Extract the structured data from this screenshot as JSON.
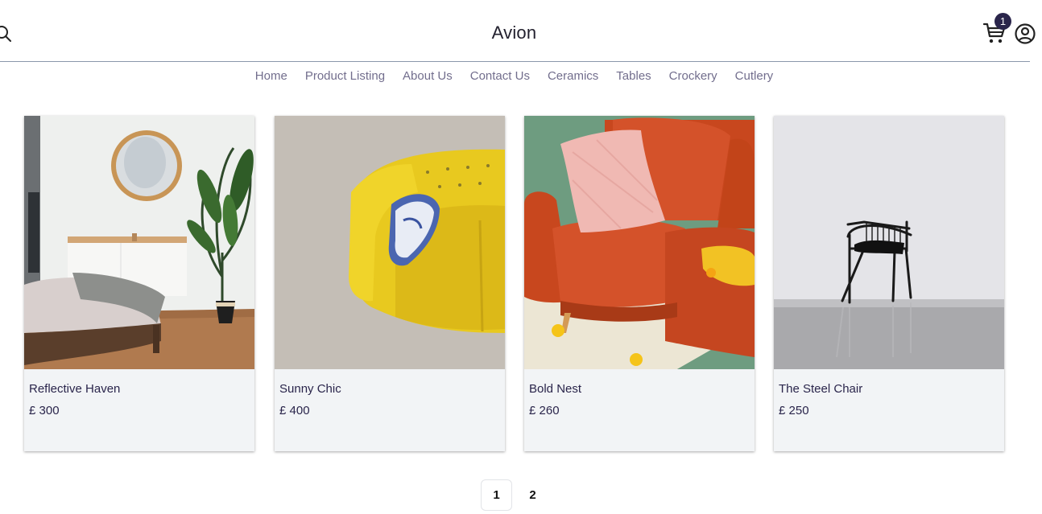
{
  "header": {
    "brand": "Avion",
    "cart_count": "1"
  },
  "nav": {
    "items": [
      "Home",
      "Product Listing",
      "About Us",
      "Contact Us",
      "Ceramics",
      "Tables",
      "Crockery",
      "Cutlery"
    ]
  },
  "products": [
    {
      "name": "Reflective Haven",
      "price": "£ 300"
    },
    {
      "name": "Sunny Chic",
      "price": "£ 400"
    },
    {
      "name": "Bold Nest",
      "price": "£ 260"
    },
    {
      "name": "The Steel Chair",
      "price": "£ 250"
    }
  ],
  "pagination": {
    "pages": [
      "1",
      "2"
    ],
    "current": "1"
  },
  "colors": {
    "brand": "#2a254b",
    "nav_text": "#726e8d",
    "card_bg": "#f2f4f6"
  }
}
